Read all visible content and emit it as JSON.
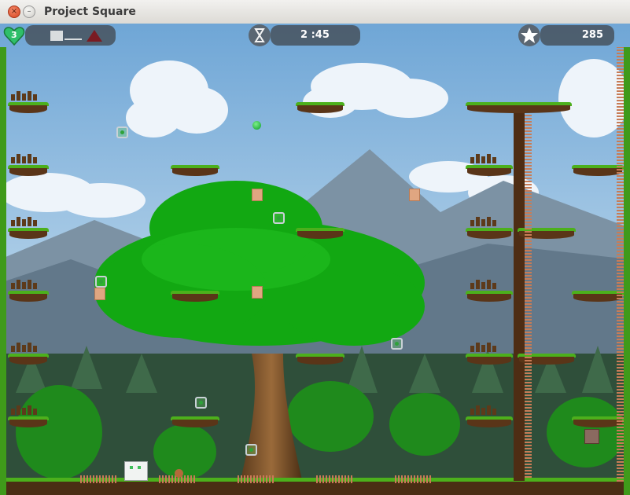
{
  "window": {
    "title": "Project Square",
    "close_glyph": "×",
    "minimize_glyph": "–"
  },
  "hud": {
    "lives": "3",
    "timer": "2 :45",
    "score": "285",
    "lives_icon": "heart-icon",
    "timer_icon": "hourglass-icon",
    "score_icon": "star-icon",
    "progress_icon": "level-progress-icon"
  },
  "colors": {
    "sky": "#8fb8de",
    "grass": "#4cb01c",
    "hud": "#485461",
    "tree": "#18b014"
  }
}
